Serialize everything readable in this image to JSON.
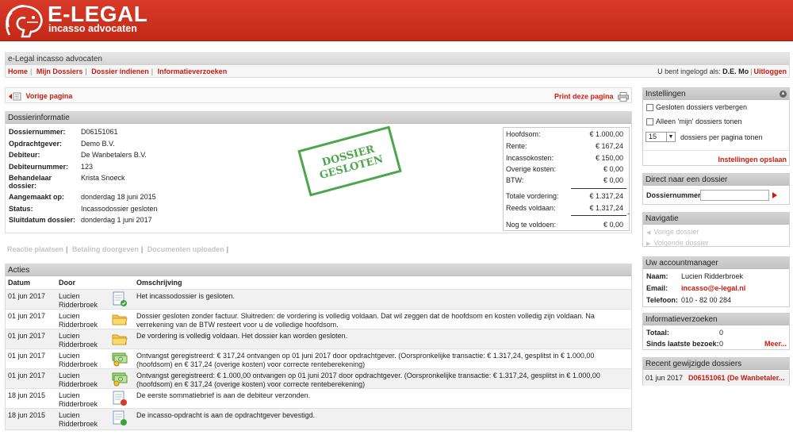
{
  "brand": {
    "title": "E-LEGAL",
    "subtitle": "incasso advocaten"
  },
  "header": {
    "site_name": "e-Legal incasso advocaten",
    "nav": [
      {
        "label": "Home"
      },
      {
        "label": "Mijn Dossiers"
      },
      {
        "label": "Dossier indienen"
      },
      {
        "label": "Informatieverzoeken"
      }
    ],
    "logged_in_prefix": "U bent ingelogd als:",
    "user": "D.E. Mo",
    "logout": "Uitloggen"
  },
  "backbar": {
    "back": "Vorige pagina",
    "print": "Print deze pagina"
  },
  "dossier": {
    "title": "Dossierinformatie",
    "fields": [
      {
        "label": "Dossiernummer:",
        "value": "D06151061"
      },
      {
        "label": "Opdrachtgever:",
        "value": "Demo B.V."
      },
      {
        "label": "Debiteur:",
        "value": "De Wanbetalers B.V."
      },
      {
        "label": "Debiteurnummer:",
        "value": "123"
      },
      {
        "label": "Behandelaar dossier:",
        "value": "Krista Snoeck"
      },
      {
        "label": "Aangemaakt op:",
        "value": "donderdag 18 juni 2015"
      },
      {
        "label": "Status:",
        "value": "Incassodossier gesloten"
      },
      {
        "label": "Sluitdatum dossier:",
        "value": "donderdag 1 juni 2017"
      }
    ],
    "stamp": {
      "line1": "DOSSIER",
      "line2": "GESLOTEN",
      "color": "#3a9c3a"
    },
    "totals": [
      {
        "label": "Hoofdsom:",
        "value": "€ 1.000,00"
      },
      {
        "label": "Rente:",
        "value": "€ 167,24"
      },
      {
        "label": "Incassokosten:",
        "value": "€ 150,00"
      },
      {
        "label": "Overige kosten:",
        "value": "€ 0,00"
      },
      {
        "label": "BTW:",
        "value": "€ 0,00"
      },
      {
        "label": "Totale vordering:",
        "value": "€ 1.317,24"
      },
      {
        "label": "Reeds voldaan:",
        "value": "€ 1.317,24"
      },
      {
        "label": "Nog te voldoen:",
        "value": "€ 0,00"
      }
    ],
    "minus_sign": "-"
  },
  "action_links": [
    "Reactie plaatsen",
    "Betaling doorgeven",
    "Documenten uploaden"
  ],
  "acties": {
    "title": "Acties",
    "columns": [
      "Datum",
      "Door",
      "Omschrijving"
    ],
    "rows": [
      {
        "date": "01 jun 2017",
        "door": "Lucien Ridderbroek",
        "icon": "closed-envelope-icon",
        "desc": "Het incassodossier is gesloten."
      },
      {
        "date": "01 jun 2017",
        "door": "Lucien Ridderbroek",
        "icon": "folder-icon",
        "desc": "Dossier gesloten zonder factuur. Sluitreden: de vordering is volledig voldaan. Dat wil zeggen dat de hoofdsom en kosten volledig zijn voldaan. Na verrekening van de BTW resteert voor u de volledige hoofdsom."
      },
      {
        "date": "01 jun 2017",
        "door": "Lucien Ridderbroek",
        "icon": "folder-icon",
        "desc": "De vordering is volledig voldaan. Het dossier kan worden gesloten."
      },
      {
        "date": "01 jun 2017",
        "door": "Lucien Ridderbroek",
        "icon": "money-icon",
        "desc": "Ontvangst geregistreerd: € 317,24 ontvangen op 01 juni 2017 door opdrachtgever. (Oorspronkelijke transactie: € 1.317,24, gesplitst in € 1.000,00 (hoofdsom) en € 317,24 (overige kosten) voor correcte renteberekening)"
      },
      {
        "date": "01 jun 2017",
        "door": "Lucien Ridderbroek",
        "icon": "money-icon",
        "desc": "Ontvangst geregistreerd: € 1.000,00 ontvangen op 01 juni 2017 door opdrachtgever. (Oorspronkelijke transactie: € 1.317,24, gesplitst in € 1.000,00 (hoofdsom) en € 317,24 (overige kosten) voor correcte renteberekening)"
      },
      {
        "date": "18 jun 2015",
        "door": "Lucien Ridderbroek",
        "icon": "red-letter-icon",
        "desc": "De eerste sommatiebrief is aan de debiteur verzonden."
      },
      {
        "date": "18 jun 2015",
        "door": "Lucien Ridderbroek",
        "icon": "green-letter-icon",
        "desc": "De incasso-opdracht is aan de opdrachtgever bevestigd."
      }
    ]
  },
  "sidebar": {
    "instellingen": {
      "title": "Instellingen",
      "opt1": "Gesloten dossiers verbergen",
      "opt2": "Alleen 'mijn' dossiers tonen",
      "per_page_value": "15",
      "per_page_label": "dossiers per pagina tonen",
      "save": "Instellingen opslaan"
    },
    "direct": {
      "title": "Direct naar een dossier",
      "label": "Dossiernummer:"
    },
    "navigatie": {
      "title": "Navigatie",
      "prev": "Vorige dossier",
      "next": "Volgende dossier"
    },
    "manager": {
      "title": "Uw accountmanager",
      "naam_label": "Naam:",
      "naam": "Lucien Ridderbroek",
      "email_label": "Email:",
      "email": "incasso@e-legal.nl",
      "tel_label": "Telefoon:",
      "tel": "010 - 82 00 284"
    },
    "info": {
      "title": "Informatieverzoeken",
      "totaal_label": "Totaal:",
      "totaal": "0",
      "sinds_label": "Sinds laatste bezoek:",
      "sinds": "0",
      "meer": "Meer..."
    },
    "recent": {
      "title": "Recent gewijzigde dossiers",
      "date": "01 jun 2017",
      "link": "D06151061 (De Wanbetaler..."
    }
  },
  "colors": {
    "brand_red": "#c8301e",
    "link_red": "#cc1a0e",
    "stamp_green": "#3a9c3a"
  }
}
